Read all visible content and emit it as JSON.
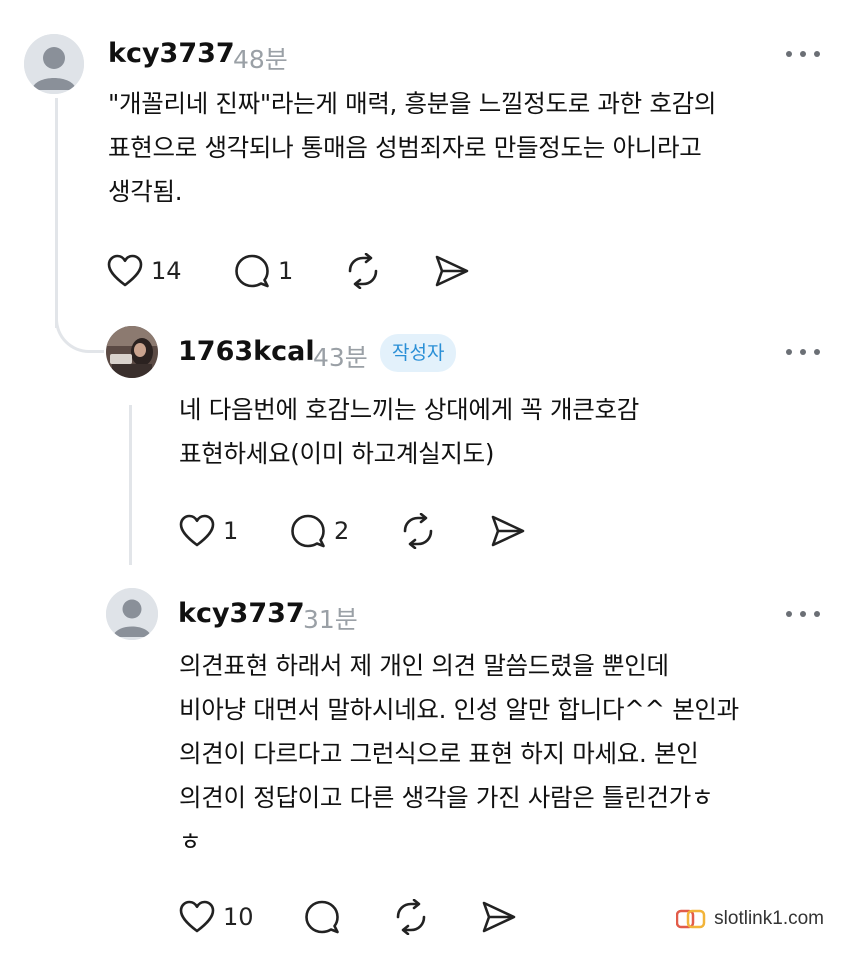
{
  "comments": [
    {
      "username": "kcy3737",
      "time": "48분",
      "text": "\"개꼴리네 진짜\"라는게 매력, 흥분을 느낄정도로 과한 호감의\n표현으로 생각되나 통매음 성범죄자로 만들정도는 아니라고\n생각됨.",
      "likes": "14",
      "replies": "1"
    },
    {
      "username": "1763kcal",
      "time": "43분",
      "badge": "작성자",
      "text": "네 다음번에 호감느끼는 상대에게 꼭 개큰호감\n표현하세요(이미 하고계실지도)",
      "likes": "1",
      "replies": "2"
    },
    {
      "username": "kcy3737",
      "time": "31분",
      "text": "의견표현 하래서 제 개인 의견 말씀드렸을 뿐인데\n비아냥 대면서 말하시네요. 인성 알만 합니다^^ 본인과\n의견이 다르다고 그런식으로 표현 하지 마세요. 본인\n의견이 정답이고 다른 생각을 가진 사람은 틀린건가ㅎ\nㅎ",
      "likes": "10",
      "replies": ""
    }
  ],
  "watermark": {
    "text": "slotlink1.com"
  },
  "icons": {
    "like": "heart-icon",
    "reply": "comment-bubble-icon",
    "repost": "repost-icon",
    "share": "send-icon",
    "more": "more-dots-icon"
  },
  "colors": {
    "badge_bg": "#e3f1fb",
    "badge_text": "#2a8fd6",
    "time": "#9aa0a6",
    "thread_line": "#e2e5e9"
  }
}
